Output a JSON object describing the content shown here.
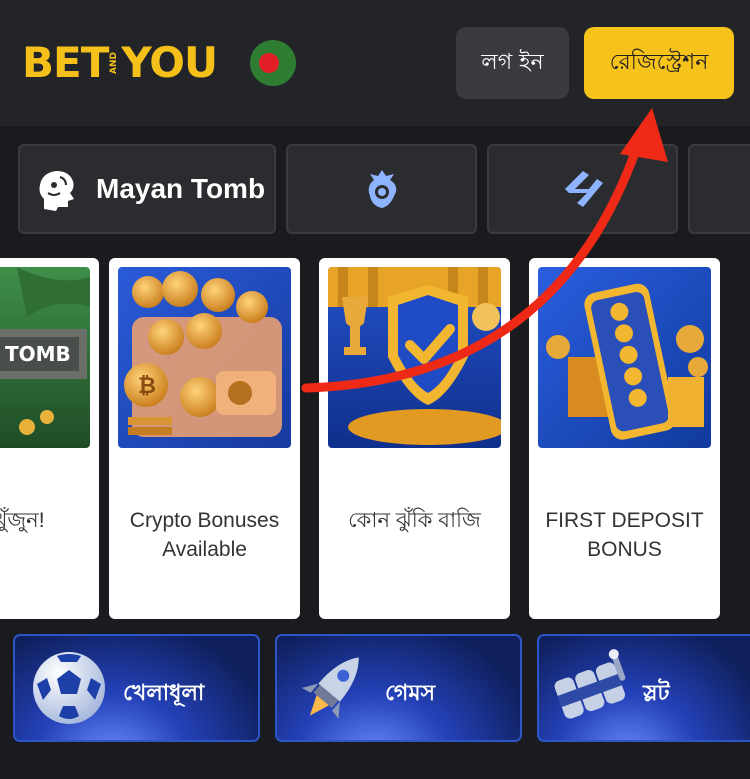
{
  "header": {
    "logo": {
      "part1": "BET",
      "part2": "AND",
      "part3": "YOU"
    },
    "flag": "bangladesh-flag",
    "login_label": "লগ ইন",
    "register_label": "রেজিস্ট্রেশন"
  },
  "categories": [
    {
      "label": "Mayan Tomb",
      "icon": "mayan-tomb-icon"
    },
    {
      "label": "",
      "icon": "premier-league-icon"
    },
    {
      "label": "",
      "icon": "laliga-icon"
    },
    {
      "label": "",
      "icon": "more-category"
    }
  ],
  "promos": [
    {
      "caption": "পদ খুঁজুন!",
      "image": "mayan-tomb-promo"
    },
    {
      "caption": "Crypto Bonuses Available",
      "image": "crypto-wallet-coins"
    },
    {
      "caption": "কোন ঝুঁকি বাজি",
      "image": "shield-trophy"
    },
    {
      "caption": "FIRST DEPOSIT BONUS",
      "image": "phone-coins"
    }
  ],
  "bottom_nav": [
    {
      "label": "খেলাধূলা",
      "icon": "soccer-ball-icon"
    },
    {
      "label": "গেমস",
      "icon": "rocket-icon"
    },
    {
      "label": "স্লট",
      "icon": "slot-reels-icon"
    }
  ],
  "colors": {
    "brand_yellow": "#f7c219",
    "header_bg": "#232427",
    "page_bg": "#1a1b1e",
    "arrow": "#ee2a17"
  }
}
